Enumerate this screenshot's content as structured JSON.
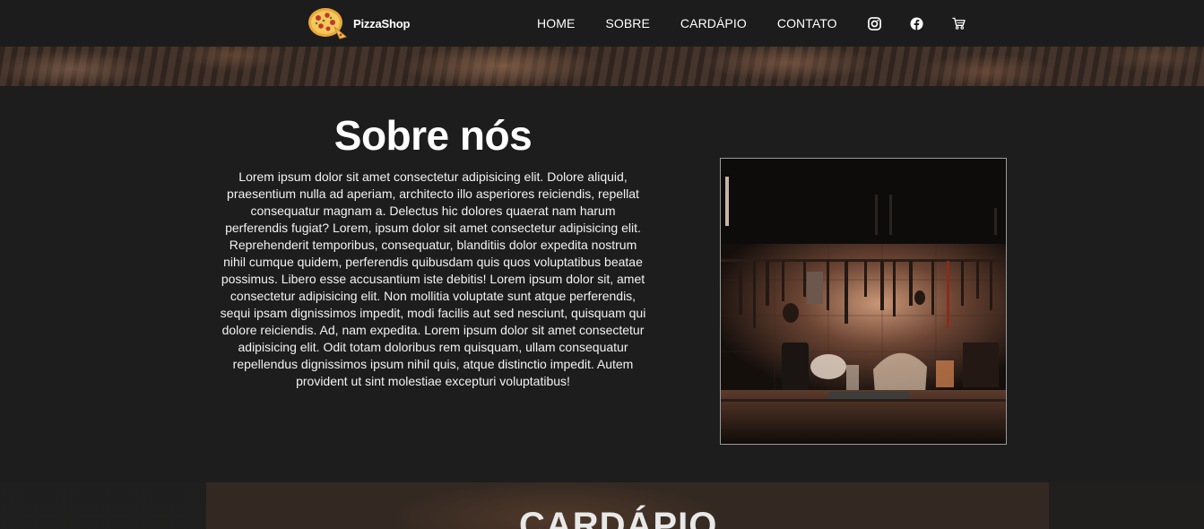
{
  "navbar": {
    "brand_name": "PizzaShop",
    "links": [
      "HOME",
      "SOBRE",
      "CARDÁPIO",
      "CONTATO"
    ],
    "icons": [
      "instagram-icon",
      "facebook-icon",
      "cart-icon"
    ]
  },
  "about": {
    "title": "Sobre nós",
    "text": "Lorem ipsum dolor sit amet consectetur adipisicing elit. Dolore aliquid, praesentium nulla ad aperiam, architecto illo asperiores reiciendis, repellat consequatur magnam a. Delectus hic dolores quaerat nam harum perferendis fugiat? Lorem, ipsum dolor sit amet consectetur adipisicing elit. Reprehenderit temporibus, consequatur, blanditiis dolor expedita nostrum nihil cumque quidem, perferendis quibusdam quis quos voluptatibus beatae possimus. Libero esse accusantium iste debitis! Lorem ipsum dolor sit, amet consectetur adipisicing elit. Non mollitia voluptate sunt atque perferendis, sequi ipsam dignissimos impedit, modi facilis aut sed nesciunt, quisquam qui dolore reiciendis. Ad, nam expedita. Lorem ipsum dolor sit amet consectetur adipisicing elit. Odit totam doloribus rem quisquam, ullam consequatur repellendus dignissimos ipsum nihil quis, atque distinctio impedit. Autem provident ut sint molestiae excepturi voluptatibus!"
  },
  "menu": {
    "title": "CARDÁPIO"
  },
  "colors": {
    "background": "#1d1d1d",
    "navbar": "#1c1c1c",
    "text": "#ffffff"
  }
}
